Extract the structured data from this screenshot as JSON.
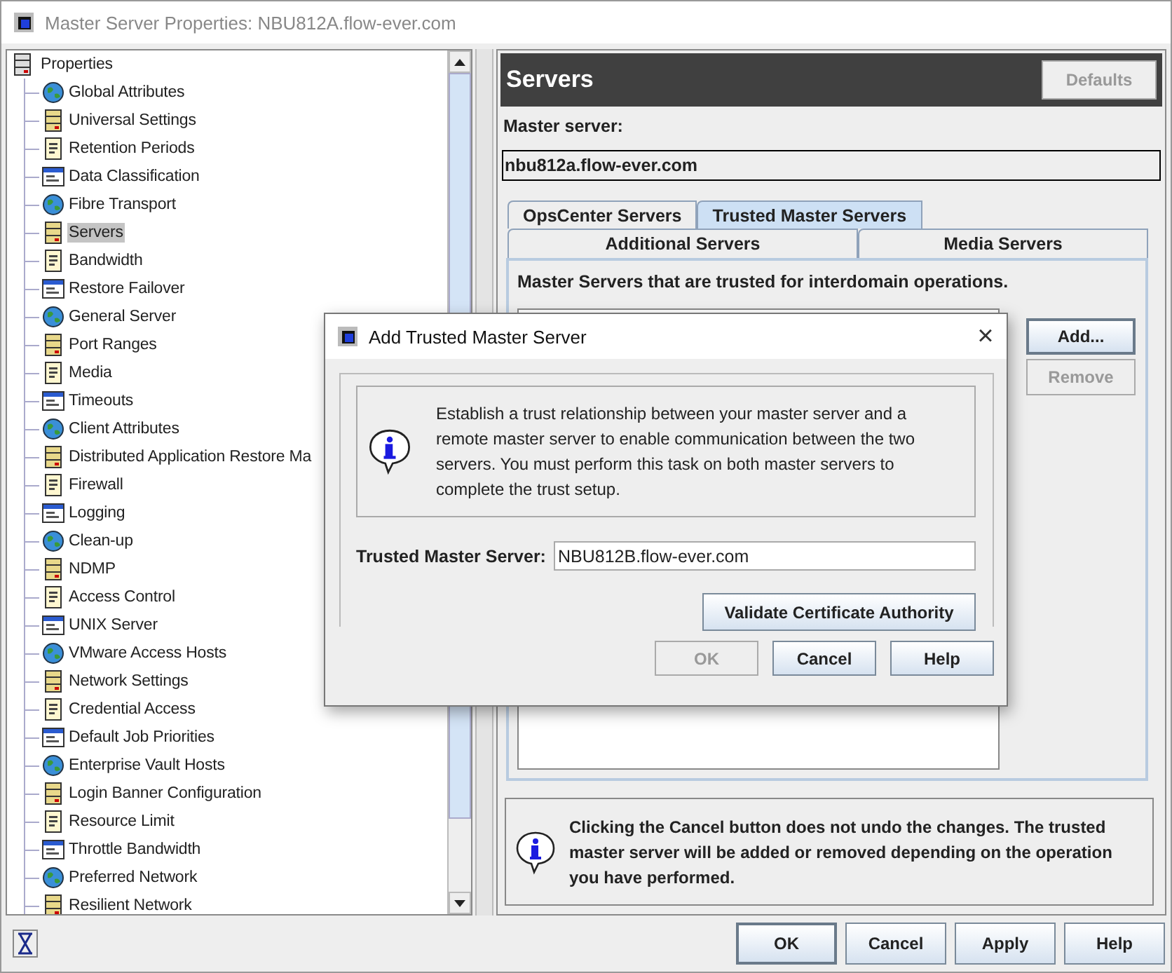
{
  "window": {
    "title": "Master Server Properties: NBU812A.flow-ever.com"
  },
  "tree": {
    "root": "Properties",
    "items": [
      {
        "label": "Global Attributes",
        "selected": false
      },
      {
        "label": "Universal Settings",
        "selected": false
      },
      {
        "label": "Retention Periods",
        "selected": false
      },
      {
        "label": "Data Classification",
        "selected": false
      },
      {
        "label": "Fibre Transport",
        "selected": false
      },
      {
        "label": "Servers",
        "selected": true
      },
      {
        "label": "Bandwidth",
        "selected": false
      },
      {
        "label": "Restore Failover",
        "selected": false
      },
      {
        "label": "General Server",
        "selected": false
      },
      {
        "label": "Port Ranges",
        "selected": false
      },
      {
        "label": "Media",
        "selected": false
      },
      {
        "label": "Timeouts",
        "selected": false
      },
      {
        "label": "Client Attributes",
        "selected": false
      },
      {
        "label": "Distributed Application Restore Ma",
        "selected": false
      },
      {
        "label": "Firewall",
        "selected": false
      },
      {
        "label": "Logging",
        "selected": false
      },
      {
        "label": "Clean-up",
        "selected": false
      },
      {
        "label": "NDMP",
        "selected": false
      },
      {
        "label": "Access Control",
        "selected": false
      },
      {
        "label": "UNIX Server",
        "selected": false
      },
      {
        "label": "VMware Access Hosts",
        "selected": false
      },
      {
        "label": "Network Settings",
        "selected": false
      },
      {
        "label": "Credential Access",
        "selected": false
      },
      {
        "label": "Default Job Priorities",
        "selected": false
      },
      {
        "label": "Enterprise Vault Hosts",
        "selected": false
      },
      {
        "label": "Login Banner Configuration",
        "selected": false
      },
      {
        "label": "Resource Limit",
        "selected": false
      },
      {
        "label": "Throttle Bandwidth",
        "selected": false
      },
      {
        "label": "Preferred Network",
        "selected": false
      },
      {
        "label": "Resilient Network",
        "selected": false
      }
    ]
  },
  "panel": {
    "title": "Servers",
    "defaults_button": {
      "label": "Defaults",
      "disabled": true
    },
    "master_label": "Master server:",
    "master_value": "nbu812a.flow-ever.com",
    "tab_rows": [
      [
        {
          "label": "OpsCenter Servers",
          "selected": false
        },
        {
          "label": "Trusted Master Servers",
          "selected": true
        }
      ],
      [
        {
          "label": "Additional Servers",
          "selected": false
        },
        {
          "label": "Media Servers",
          "selected": false
        }
      ]
    ],
    "tab_caption": "Master Servers that are trusted for interdomain operations.",
    "side_buttons": [
      {
        "label": "Add...",
        "disabled": false,
        "default": true
      },
      {
        "label": "Remove",
        "disabled": true,
        "default": false
      }
    ],
    "note": "Clicking the Cancel button does not undo the changes. The trusted master server will be added or removed depending on the operation you have performed."
  },
  "buttons": [
    {
      "label": "OK",
      "disabled": false,
      "default": true
    },
    {
      "label": "Cancel",
      "disabled": false,
      "default": false
    },
    {
      "label": "Apply",
      "disabled": false,
      "default": false
    },
    {
      "label": "Help",
      "disabled": false,
      "default": false
    }
  ],
  "dialog": {
    "title": "Add Trusted Master Server",
    "close": "×",
    "info": "Establish a trust relationship between your master server and a remote master server to enable communication between the two servers. You must perform this task on both master servers to complete the trust setup.",
    "field_label": "Trusted Master Server:",
    "field_value": "NBU812B.flow-ever.com",
    "validate_button": {
      "label": "Validate Certificate Authority",
      "disabled": false,
      "default": false
    },
    "buttons": [
      {
        "label": "OK",
        "disabled": true,
        "default": false
      },
      {
        "label": "Cancel",
        "disabled": false,
        "default": false
      },
      {
        "label": "Help",
        "disabled": false,
        "default": false
      }
    ]
  }
}
